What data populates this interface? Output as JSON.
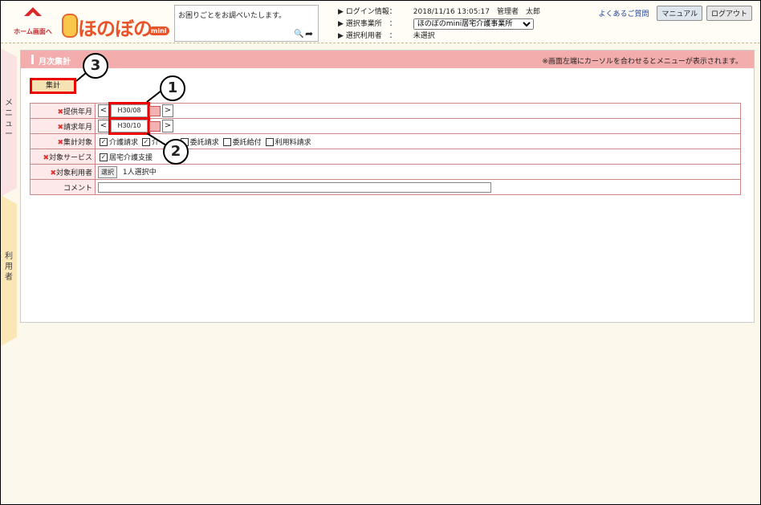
{
  "header": {
    "home_label": "ホーム画面へ",
    "logo_text": "ほのぼの",
    "logo_badge": "mini",
    "help_text": "お困りごとをお調べいたします。",
    "search_icon": "🔍",
    "go_icon": "➦",
    "login_label": "ログイン情報：",
    "login_value": "2018/11/16 13:05:17　管理者　太郎",
    "office_label": "選択事業所　：",
    "office_value": "ほのぼのmini居宅介護事業所",
    "user_label": "選択利用者　：",
    "user_value": "未選択",
    "faq_link": "よくあるご質問",
    "manual_button": "マニュアル",
    "logout_button": "ログアウト"
  },
  "side": {
    "menu_tab": "メニュー",
    "user_tab": "利用者"
  },
  "main": {
    "title": "月次集計",
    "note": "※画面左端にカーソルを合わせるとメニューが表示されます。",
    "calc_button": "集計",
    "rows": {
      "service_month_label": "提供年月",
      "service_month_value": "H30/08",
      "billing_month_label": "請求年月",
      "billing_month_value": "H30/10",
      "target_label": "集計対象",
      "target_options": [
        "介護請求",
        "介",
        "委託請求",
        "委託給付",
        "利用料請求"
      ],
      "service_label": "対象サービス",
      "service_option": "居宅介護支援",
      "users_label": "対象利用者",
      "select_button": "選択",
      "users_value": "1人選択中",
      "comment_label": "コメント"
    },
    "required_mark": "✖"
  },
  "callouts": [
    "1",
    "2",
    "3"
  ],
  "colors": {
    "title_bar": "#f4adad",
    "highlight": "#e00000",
    "label_bg": "#fde9e9"
  }
}
